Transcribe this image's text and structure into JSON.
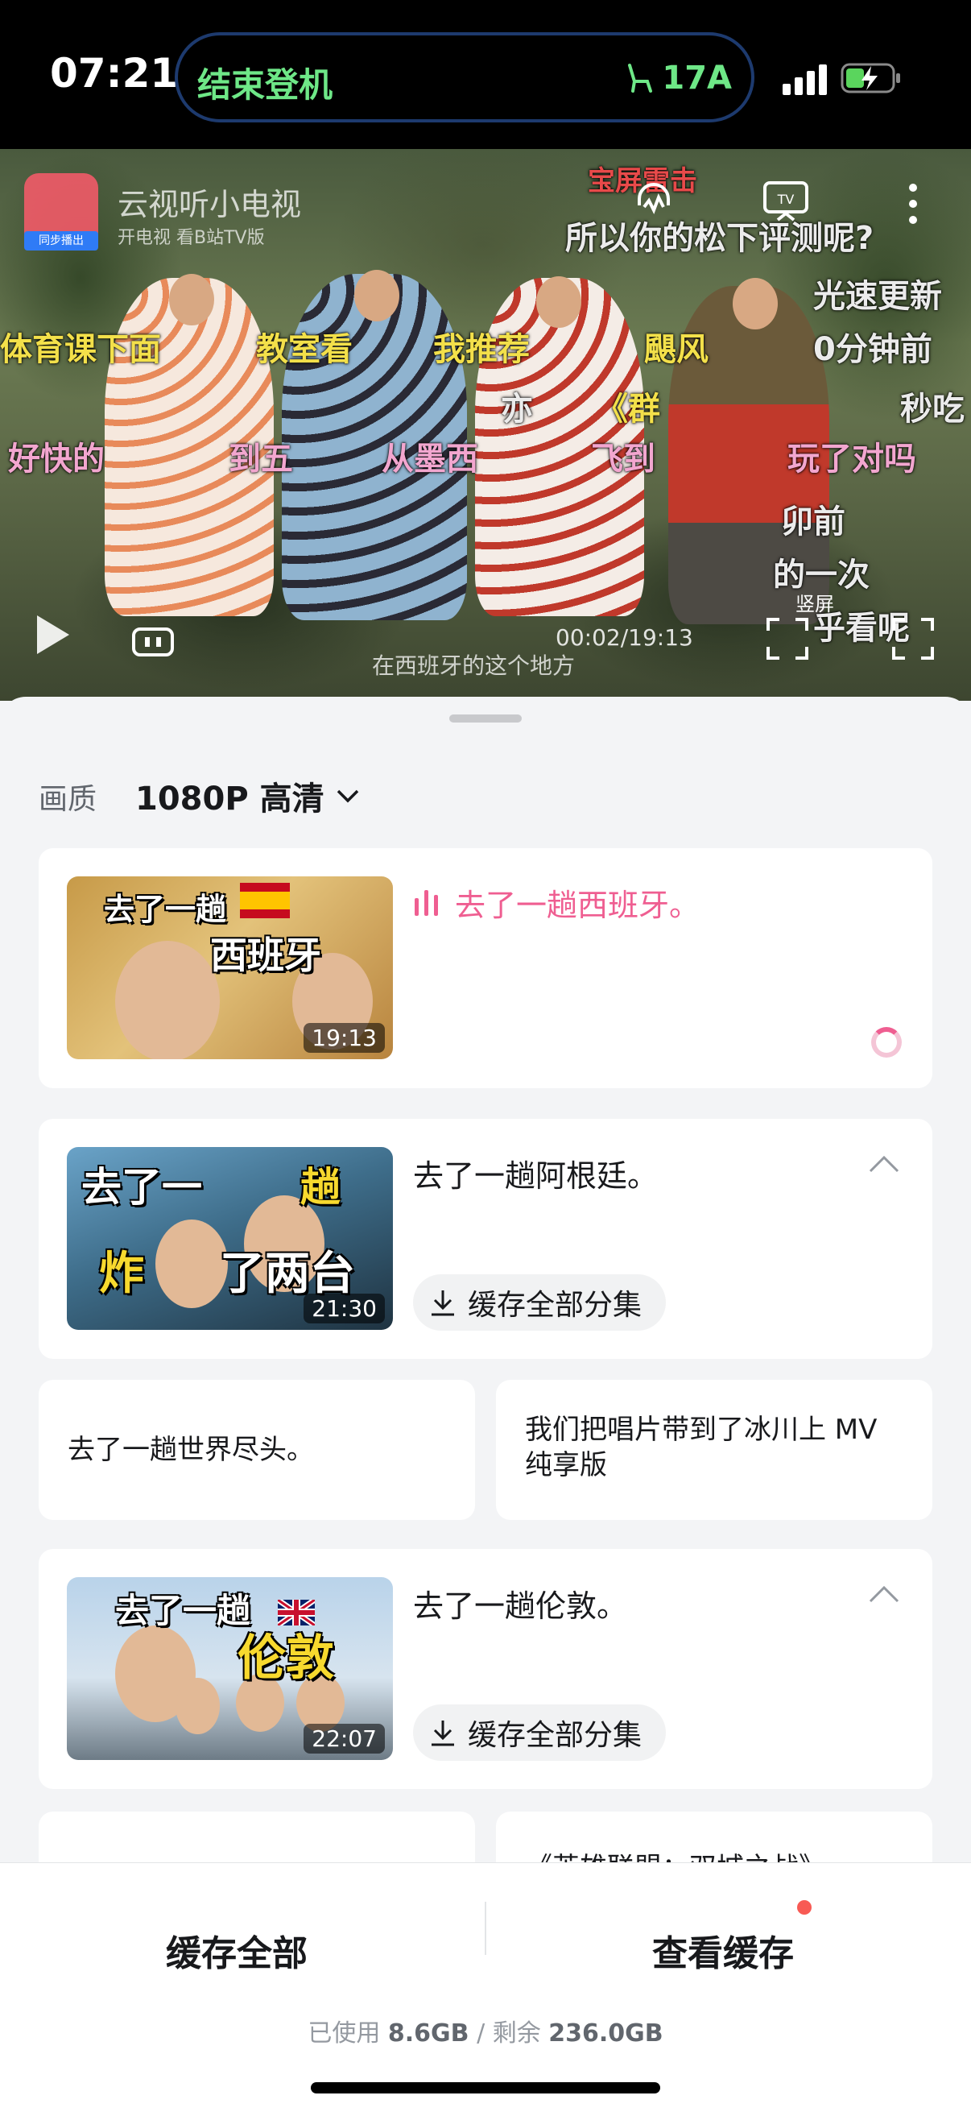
{
  "status_bar": {
    "time": "07:21",
    "activity": "结束登机",
    "seat": "17A"
  },
  "video": {
    "app_name": "云视听小电视",
    "app_sub": "开电视 看B站TV版",
    "app_badge": "同步播出",
    "danmaku": [
      "所以你的松下评测呢?",
      "光速更新",
      "体育课下面",
      "教室看",
      "我推荐",
      "颶风",
      "0分钟前",
      "秒吃",
      "亦",
      "《群",
      "好快的",
      "到五",
      "从墨西",
      "飞到",
      "玩了对吗",
      "卯前",
      "的一次",
      "乎看呢",
      "宝屏雷击"
    ],
    "current_time": "00:02/19:13",
    "subtitle": "在西班牙的这个地方",
    "portrait_label": "竖屏"
  },
  "sheet": {
    "quality_label": "画质",
    "quality_value": "1080P 高清",
    "download_all_label": "缓存全部分集",
    "episodes": [
      {
        "title": "去了一趟西班牙。",
        "duration": "19:13",
        "thumb_line1": "去了一趟",
        "thumb_line2": "西班牙"
      },
      {
        "title": "去了一趟阿根廷。",
        "duration": "21:30",
        "thumb_line1": "去了一",
        "thumb_line1b": "趟",
        "thumb_line2": "炸",
        "thumb_line2b": "了两台"
      },
      {
        "title": "去了一趟世界尽头。"
      },
      {
        "title": "我们把唱片带到了冰川上 MV 纯享版"
      },
      {
        "title": "去了一趟伦敦。",
        "duration": "22:07",
        "thumb_line1": "去了一趟",
        "thumb_line2": "伦敦"
      },
      {
        "title": "《英雄联盟：双城之战》"
      }
    ]
  },
  "bottom_bar": {
    "cache_all": "缓存全部",
    "view_cache": "查看缓存",
    "used_label": "已使用",
    "used_value": "8.6GB",
    "separator": "/",
    "remaining_label": "剩余",
    "remaining_value": "236.0GB"
  },
  "colors": {
    "accent_pink": "#ef5e91",
    "island_text": "#6ee787",
    "badge_red": "#f85a54"
  }
}
